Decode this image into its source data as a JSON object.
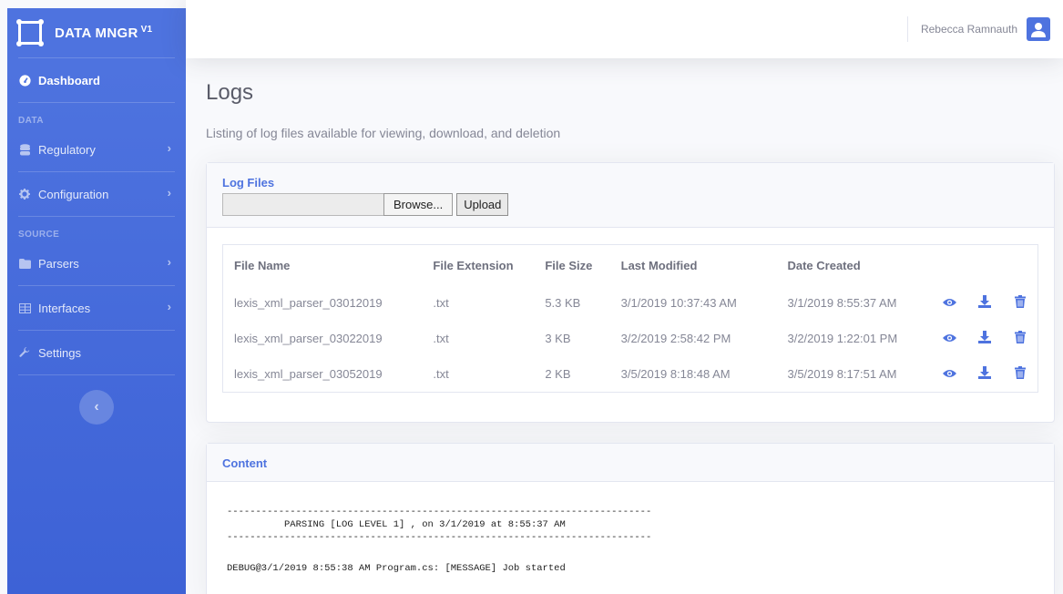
{
  "brand": {
    "title": "DATA MNGR",
    "version": "V1"
  },
  "sidebar": {
    "dashboard": "Dashboard",
    "heading_data": "DATA",
    "heading_source": "SOURCE",
    "items": [
      {
        "label": "Regulatory",
        "icon": "database-icon"
      },
      {
        "label": "Configuration",
        "icon": "gear-icon"
      },
      {
        "label": "Parsers",
        "icon": "folder-icon"
      },
      {
        "label": "Interfaces",
        "icon": "table-icon"
      },
      {
        "label": "Settings",
        "icon": "wrench-icon"
      }
    ],
    "toggle_glyph": "‹"
  },
  "topbar": {
    "user_name": "Rebecca Ramnauth"
  },
  "page": {
    "title": "Logs",
    "subtitle": "Listing of log files available for viewing, download, and deletion"
  },
  "log_files": {
    "title": "Log Files",
    "browse_label": "Browse...",
    "upload_label": "Upload",
    "columns": [
      "File Name",
      "File Extension",
      "File Size",
      "Last Modified",
      "Date Created"
    ],
    "rows": [
      [
        "lexis_xml_parser_03012019",
        ".txt",
        "5.3 KB",
        "3/1/2019 10:37:43 AM",
        "3/1/2019 8:55:37 AM"
      ],
      [
        "lexis_xml_parser_03022019",
        ".txt",
        "3 KB",
        "3/2/2019 2:58:42 PM",
        "3/2/2019 1:22:01 PM"
      ],
      [
        "lexis_xml_parser_03052019",
        ".txt",
        "2 KB",
        "3/5/2019 8:18:48 AM",
        "3/5/2019 8:17:51 AM"
      ]
    ]
  },
  "content": {
    "title": "Content",
    "lines": [
      "--------------------------------------------------------------------------",
      "          PARSING [LOG LEVEL 1] , on 3/1/2019 at 8:55:37 AM",
      "--------------------------------------------------------------------------",
      "",
      "DEBUG@3/1/2019 8:55:38 AM Program.cs: [MESSAGE] Job started"
    ]
  },
  "colors": {
    "primary": "#4e73df",
    "text": "#858796"
  }
}
